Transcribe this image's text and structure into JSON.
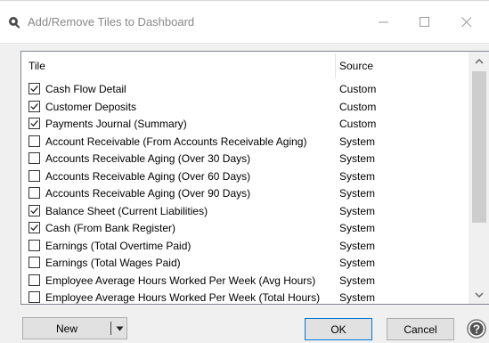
{
  "window": {
    "title": "Add/Remove Tiles to Dashboard",
    "controls": [
      "minimize-icon",
      "maximize-icon",
      "close-icon"
    ]
  },
  "table": {
    "columns": {
      "tile": "Tile",
      "source": "Source"
    },
    "rows": [
      {
        "tile": "Cash Flow Detail",
        "source": "Custom",
        "checked": true
      },
      {
        "tile": "Customer Deposits",
        "source": "Custom",
        "checked": true
      },
      {
        "tile": "Payments Journal (Summary)",
        "source": "Custom",
        "checked": true
      },
      {
        "tile": "Account Receivable (From Accounts Receivable Aging)",
        "source": "System",
        "checked": false
      },
      {
        "tile": "Accounts Receivable Aging (Over 30 Days)",
        "source": "System",
        "checked": false
      },
      {
        "tile": "Accounts Receivable Aging (Over 60 Days)",
        "source": "System",
        "checked": false
      },
      {
        "tile": "Accounts Receivable Aging (Over 90 Days)",
        "source": "System",
        "checked": false
      },
      {
        "tile": "Balance Sheet (Current Liabilities)",
        "source": "System",
        "checked": true
      },
      {
        "tile": "Cash (From Bank Register)",
        "source": "System",
        "checked": true
      },
      {
        "tile": "Earnings (Total Overtime Paid)",
        "source": "System",
        "checked": false
      },
      {
        "tile": "Earnings (Total Wages Paid)",
        "source": "System",
        "checked": false
      },
      {
        "tile": "Employee Average Hours Worked Per Week (Avg Hours)",
        "source": "System",
        "checked": false
      },
      {
        "tile": "Employee Average Hours Worked Per Week (Total Hours)",
        "source": "System",
        "checked": false
      }
    ]
  },
  "buttons": {
    "new": "New",
    "ok": "OK",
    "cancel": "Cancel"
  },
  "icons": {
    "app": "app-icon",
    "new_dropdown": "chevron-down-icon",
    "help": "help-icon",
    "scroll_up": "scroll-up-icon",
    "scroll_down": "scroll-down-icon"
  }
}
